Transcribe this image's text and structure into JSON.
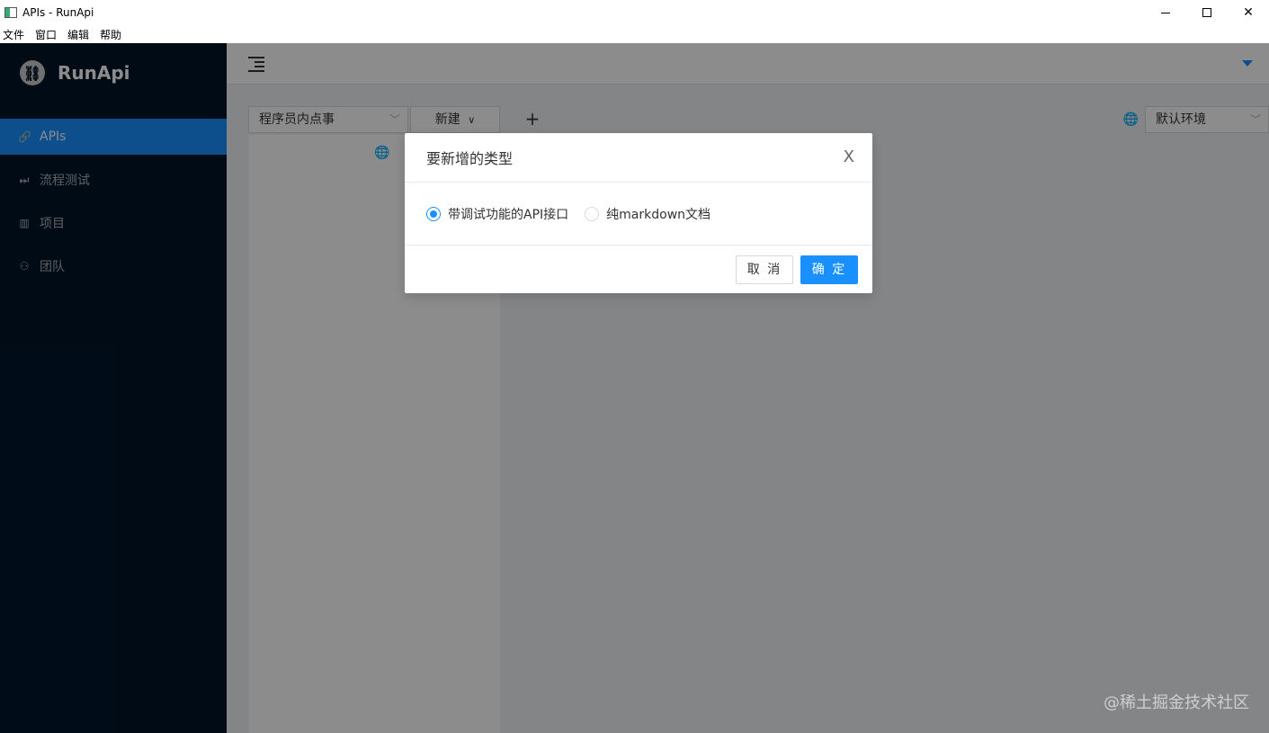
{
  "window": {
    "title": "APIs - RunApi"
  },
  "menubar": {
    "items": [
      "文件",
      "窗口",
      "编辑",
      "帮助"
    ]
  },
  "sidebar": {
    "logo_text": "RunApi",
    "items": [
      {
        "label": "APIs",
        "icon": "link-icon",
        "active": true
      },
      {
        "label": "流程测试",
        "icon": "fast-forward-icon"
      },
      {
        "label": "项目",
        "icon": "project-icon"
      },
      {
        "label": "团队",
        "icon": "team-icon"
      }
    ]
  },
  "toolbar": {
    "project_select_value": "程序员内点事",
    "new_select_label": "新建",
    "env_select_value": "默认环境"
  },
  "modal": {
    "title": "要新增的类型",
    "options": [
      {
        "label": "带调试功能的API接口",
        "checked": true
      },
      {
        "label": "纯markdown文档",
        "checked": false
      }
    ],
    "cancel_label": "取 消",
    "ok_label": "确 定"
  },
  "watermark": "@稀土掘金技术社区",
  "colors": {
    "primary": "#1890ff",
    "sidebar_bg": "#001529"
  }
}
